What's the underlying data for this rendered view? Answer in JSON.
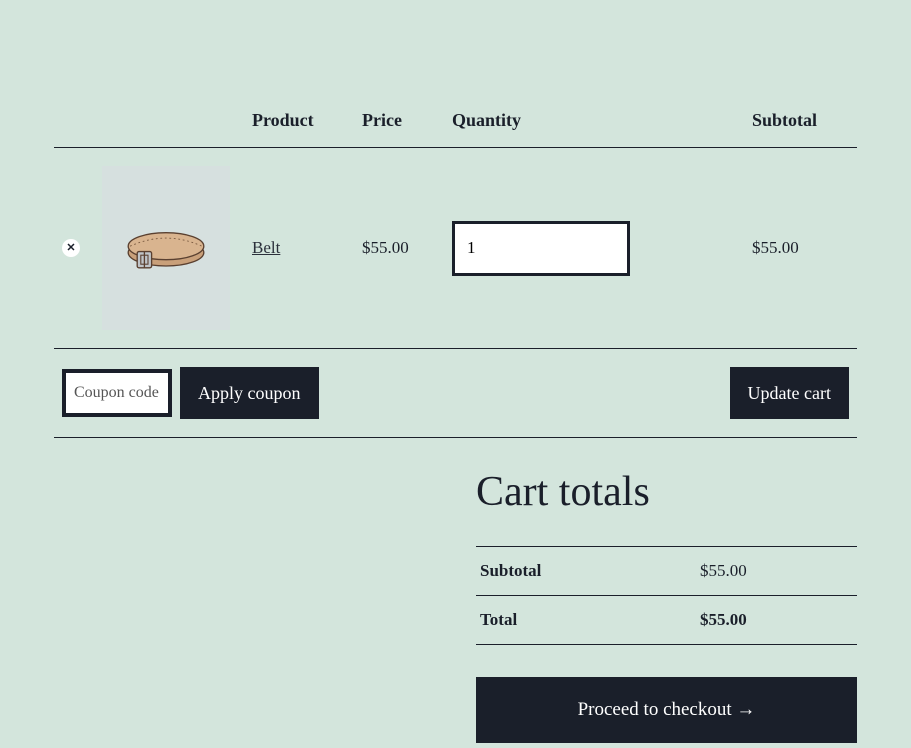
{
  "headers": {
    "product": "Product",
    "price": "Price",
    "quantity": "Quantity",
    "subtotal": "Subtotal"
  },
  "item": {
    "name": "Belt",
    "price": "$55.00",
    "quantity": "1",
    "subtotal": "$55.00"
  },
  "coupon": {
    "placeholder": "Coupon code",
    "apply_label": "Apply coupon"
  },
  "update_label": "Update cart",
  "totals": {
    "heading": "Cart totals",
    "subtotal_label": "Subtotal",
    "subtotal_value": "$55.00",
    "total_label": "Total",
    "total_value": "$55.00"
  },
  "checkout_label": "Proceed to checkout  →"
}
